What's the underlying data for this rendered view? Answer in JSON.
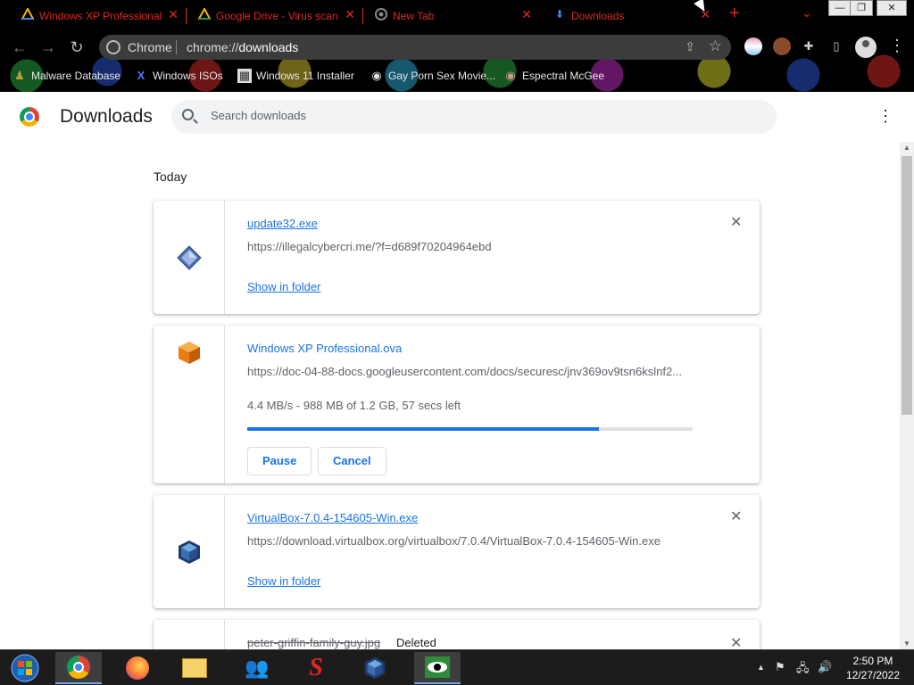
{
  "tabs": [
    {
      "title": "Windows XP Professional",
      "favicon": "google-drive-icon"
    },
    {
      "title": "Google Drive - Virus scan",
      "favicon": "google-drive-icon"
    },
    {
      "title": "New Tab",
      "favicon": "chrome-icon"
    },
    {
      "title": "Downloads",
      "favicon": "download-icon",
      "active": true
    }
  ],
  "omnibox": {
    "site_label": "Chrome",
    "url_prefix": "chrome://",
    "url_path": "downloads"
  },
  "bookmarks": [
    {
      "label": "Malware Database",
      "icon": "person-icon"
    },
    {
      "label": "Windows ISOs",
      "icon": "x-logo-icon"
    },
    {
      "label": "Windows 11 Installer",
      "icon": "image-icon"
    },
    {
      "label": "Gay Porn Sex Movie...",
      "icon": "site-icon"
    },
    {
      "label": "Espectral McGee",
      "icon": "site-icon"
    }
  ],
  "page": {
    "title": "Downloads",
    "search_placeholder": "Search downloads",
    "section_label": "Today"
  },
  "downloads": [
    {
      "file_name": "update32.exe",
      "url": "https://illegalcybercri.me/?f=d689f70204964ebd",
      "action": "Show in folder",
      "icon": "exe-diamond-icon"
    },
    {
      "file_name": "Windows XP Professional.ova",
      "url": "https://doc-04-88-docs.googleusercontent.com/docs/securesc/jnv369ov9tsn6kslnf2...",
      "status": "4.4 MB/s - 988 MB of 1.2 GB, 57 secs left",
      "progress_fraction": 0.79,
      "pause_label": "Pause",
      "cancel_label": "Cancel",
      "icon": "orange-box-icon"
    },
    {
      "file_name": "VirtualBox-7.0.4-154605-Win.exe",
      "url": "https://download.virtualbox.org/virtualbox/7.0.4/VirtualBox-7.0.4-154605-Win.exe",
      "action": "Show in folder",
      "icon": "virtualbox-icon"
    },
    {
      "file_name": "peter-griffin-family-guy.jpg",
      "state": "Deleted"
    }
  ],
  "taskbar": {
    "clock_time": "2:50 PM",
    "clock_date": "12/27/2022"
  },
  "colors": {
    "accent": "#1a73e8",
    "tab_text": "#e0281e",
    "chrome_bg": "#000000",
    "taskbar_bg": "#1c1c1c"
  }
}
